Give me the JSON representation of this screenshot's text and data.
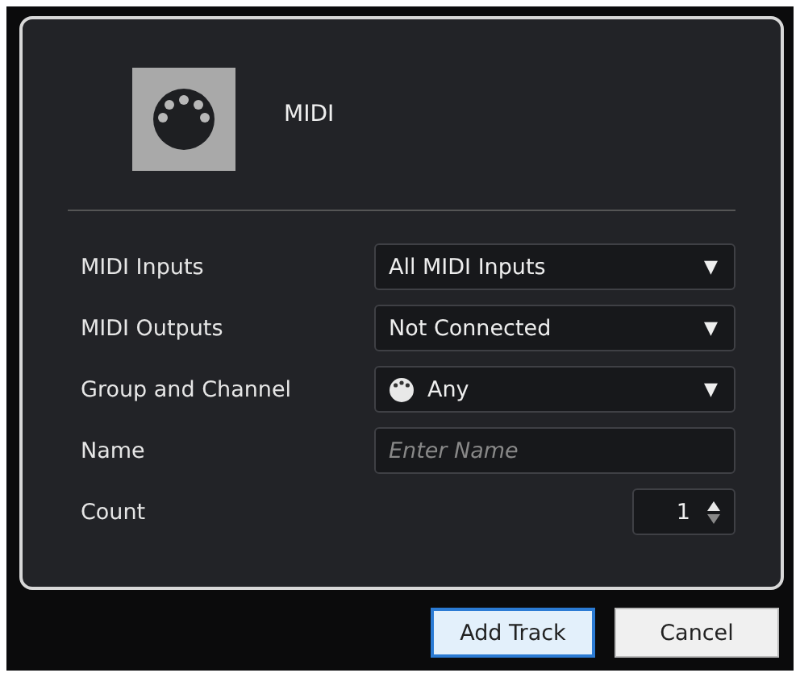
{
  "track_type": {
    "label": "MIDI"
  },
  "fields": [
    {
      "label": "MIDI Inputs",
      "kind": "dropdown",
      "value": "All MIDI Inputs",
      "arrow": "▼"
    },
    {
      "label": "MIDI Outputs",
      "kind": "dropdown",
      "value": "Not Connected",
      "arrow": "▼"
    },
    {
      "label": "Group and Channel",
      "kind": "dropdown",
      "value": "Any",
      "arrow": "▼",
      "icon": true
    },
    {
      "label": "Name",
      "kind": "text",
      "placeholder": "Enter Name"
    },
    {
      "label": "Count",
      "kind": "spinner",
      "value": "1"
    }
  ],
  "buttons": [
    {
      "label": "Add Track",
      "focused": true
    },
    {
      "label": "Cancel",
      "focused": false
    }
  ]
}
